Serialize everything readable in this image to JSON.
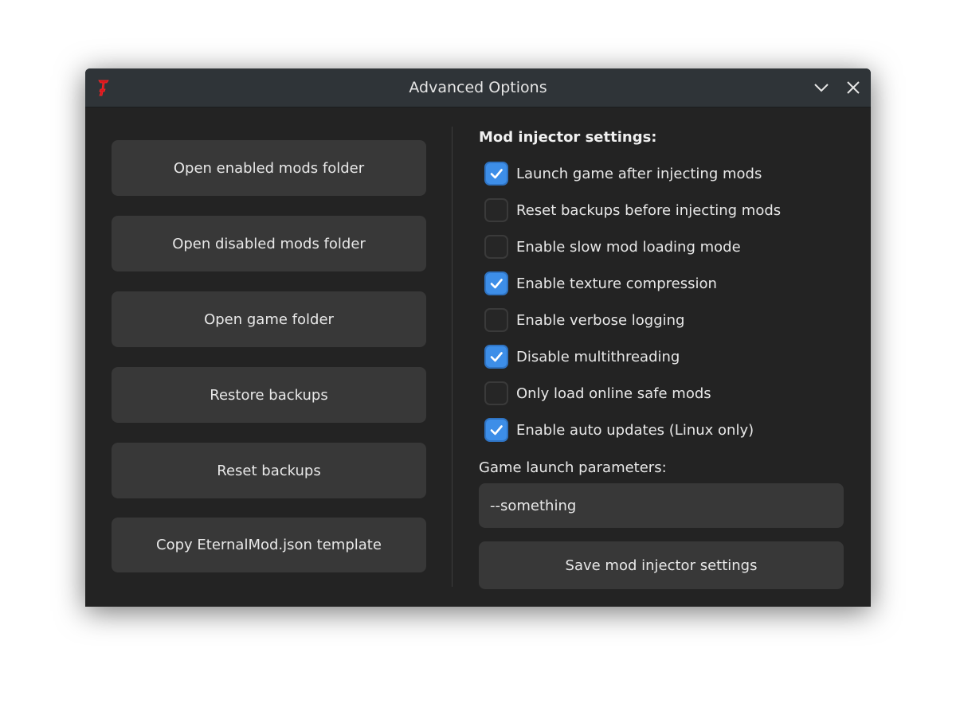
{
  "window": {
    "title": "Advanced Options",
    "icons": {
      "app": "eternal-mod-logo-icon",
      "minimize": "chevron-down-icon",
      "close": "close-icon"
    }
  },
  "left_buttons": [
    {
      "label": "Open enabled mods folder"
    },
    {
      "label": "Open disabled mods folder"
    },
    {
      "label": "Open game folder"
    },
    {
      "label": "Restore backups"
    },
    {
      "label": "Reset backups"
    },
    {
      "label": "Copy EternalMod.json template"
    }
  ],
  "settings": {
    "title": "Mod injector settings:",
    "options": [
      {
        "label": "Launch game after injecting mods",
        "checked": true
      },
      {
        "label": "Reset backups before injecting mods",
        "checked": false
      },
      {
        "label": "Enable slow mod loading mode",
        "checked": false
      },
      {
        "label": "Enable texture compression",
        "checked": true
      },
      {
        "label": "Enable verbose logging",
        "checked": false
      },
      {
        "label": "Disable multithreading",
        "checked": true
      },
      {
        "label": "Only load online safe mods",
        "checked": false
      },
      {
        "label": "Enable auto updates (Linux only)",
        "checked": true
      }
    ],
    "launch_params_label": "Game launch parameters:",
    "launch_params_value": "--something",
    "save_label": "Save mod injector settings"
  },
  "colors": {
    "accent": "#3d8ee8",
    "window_bg": "#232323",
    "titlebar_bg": "#2f3438",
    "button_bg": "#383838",
    "logo": "#d9141b"
  }
}
